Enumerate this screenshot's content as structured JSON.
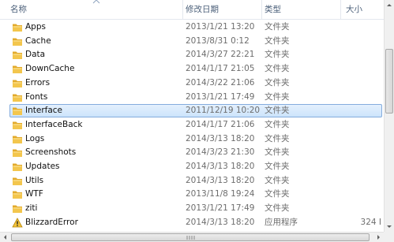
{
  "columns": {
    "name": "名称",
    "date": "修改日期",
    "type": "类型",
    "size": "大小"
  },
  "files": [
    {
      "name": "Apps",
      "date": "2013/1/21 13:20",
      "type": "文件夹",
      "size": "",
      "icon": "folder-icon",
      "selected": false
    },
    {
      "name": "Cache",
      "date": "2013/8/31 0:12",
      "type": "文件夹",
      "size": "",
      "icon": "folder-icon",
      "selected": false
    },
    {
      "name": "Data",
      "date": "2014/3/27 22:21",
      "type": "文件夹",
      "size": "",
      "icon": "folder-icon",
      "selected": false
    },
    {
      "name": "DownCache",
      "date": "2014/1/17 21:05",
      "type": "文件夹",
      "size": "",
      "icon": "folder-icon",
      "selected": false
    },
    {
      "name": "Errors",
      "date": "2014/3/22 21:06",
      "type": "文件夹",
      "size": "",
      "icon": "folder-icon",
      "selected": false
    },
    {
      "name": "Fonts",
      "date": "2013/1/21 17:49",
      "type": "文件夹",
      "size": "",
      "icon": "folder-icon",
      "selected": false
    },
    {
      "name": "Interface",
      "date": "2011/12/19 10:20",
      "type": "文件夹",
      "size": "",
      "icon": "folder-icon",
      "selected": true
    },
    {
      "name": "InterfaceBack",
      "date": "2014/1/17 21:06",
      "type": "文件夹",
      "size": "",
      "icon": "folder-icon",
      "selected": false
    },
    {
      "name": "Logs",
      "date": "2014/3/13 18:20",
      "type": "文件夹",
      "size": "",
      "icon": "folder-icon",
      "selected": false
    },
    {
      "name": "Screenshots",
      "date": "2014/3/23 21:30",
      "type": "文件夹",
      "size": "",
      "icon": "folder-icon",
      "selected": false
    },
    {
      "name": "Updates",
      "date": "2014/3/13 18:20",
      "type": "文件夹",
      "size": "",
      "icon": "folder-icon",
      "selected": false
    },
    {
      "name": "Utils",
      "date": "2014/3/13 18:20",
      "type": "文件夹",
      "size": "",
      "icon": "folder-icon",
      "selected": false
    },
    {
      "name": "WTF",
      "date": "2013/11/8 19:24",
      "type": "文件夹",
      "size": "",
      "icon": "folder-icon",
      "selected": false
    },
    {
      "name": "ziti",
      "date": "2013/1/21 17:49",
      "type": "文件夹",
      "size": "",
      "icon": "folder-icon",
      "selected": false
    },
    {
      "name": "BlizzardError",
      "date": "2014/3/13 18:20",
      "type": "应用程序",
      "size": "324 I",
      "icon": "warning-app-icon",
      "selected": false
    }
  ],
  "colors": {
    "folder": "#f3c64d",
    "selection": "#cce4fb",
    "header_text": "#4c607a"
  }
}
